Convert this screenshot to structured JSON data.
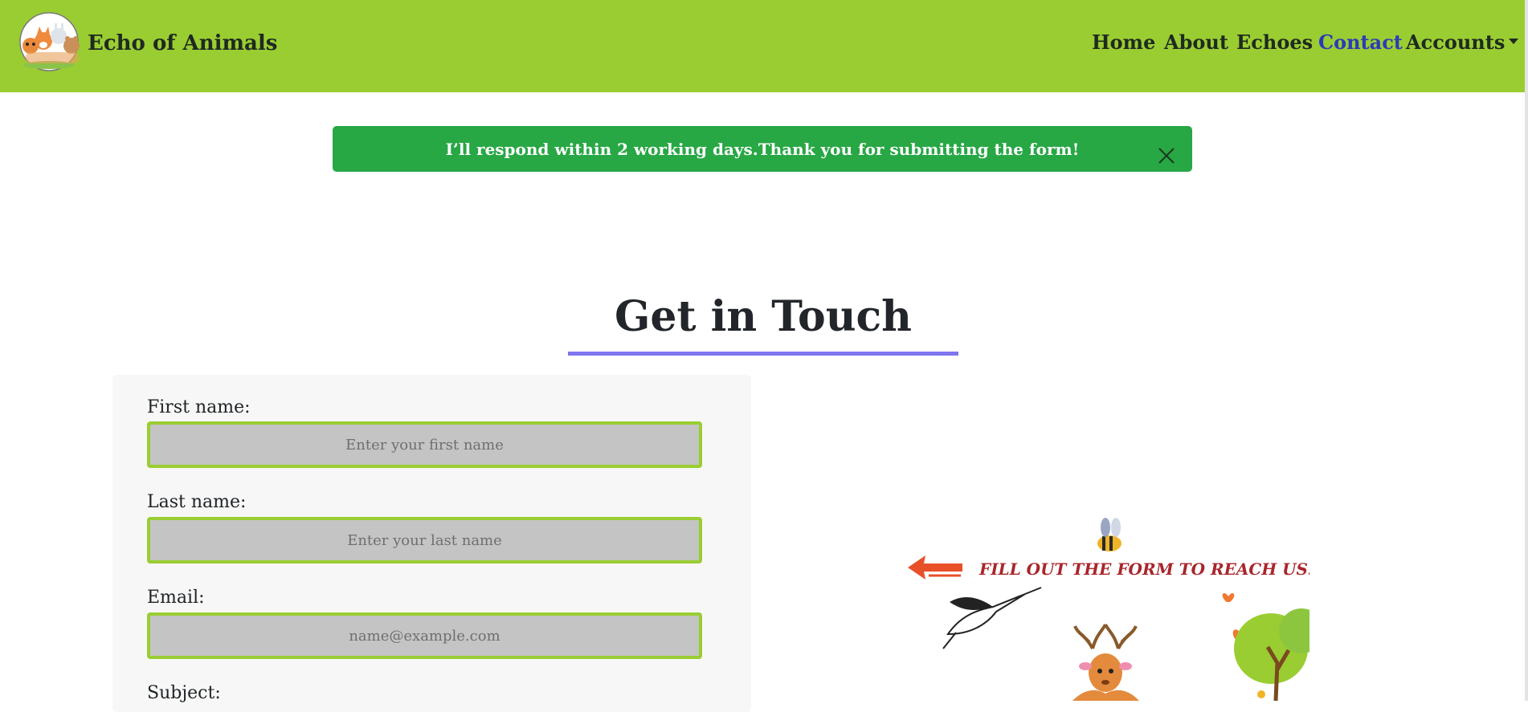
{
  "navbar": {
    "brand": "Echo of Animals",
    "items": [
      {
        "label": "Home"
      },
      {
        "label": "About"
      },
      {
        "label": "Echoes"
      },
      {
        "label": "Contact",
        "active": true
      },
      {
        "label": "Accounts",
        "dropdown": true
      }
    ]
  },
  "alert": {
    "message": "I’ll respond within 2 working days.Thank you for submitting the form!"
  },
  "main": {
    "title": "Get in Touch"
  },
  "form": {
    "first_name_label": "First name:",
    "first_name_placeholder": "Enter your first name",
    "last_name_label": "Last name:",
    "last_name_placeholder": "Enter your last name",
    "email_label": "Email:",
    "email_placeholder": "name@example.com",
    "subject_label": "Subject:"
  },
  "illustration": {
    "caption": "FILL OUT THE FORM TO REACH US."
  },
  "colors": {
    "navbar_bg": "#9acd32",
    "alert_bg": "#28a745",
    "active_link": "#2b3bb7",
    "heading_underline": "#7f77f0",
    "input_border": "#9acd32",
    "caption": "#a8262c"
  }
}
